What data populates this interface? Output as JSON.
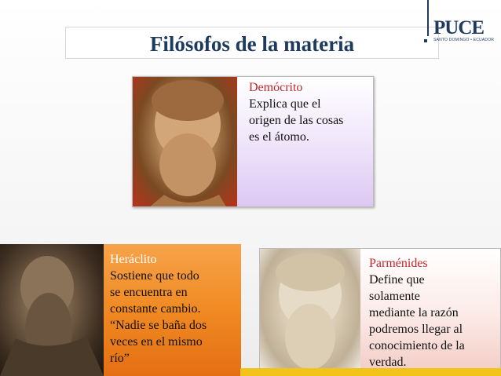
{
  "slide": {
    "title": "Filósofos de la materia"
  },
  "logo": {
    "name": "PUCE",
    "subtitle": "SANTO DOMINGO • ECUADOR"
  },
  "cards": {
    "democrito": {
      "name": "Demócrito",
      "lines": [
        "Explica que el",
        "origen de las cosas",
        "es el átomo."
      ]
    },
    "heraclito": {
      "name": "Heráclito",
      "lines": [
        "Sostiene que todo",
        "se encuentra en",
        "constante cambio.",
        "“Nadie se baña dos",
        "veces en el mismo",
        "río”"
      ]
    },
    "parmenides": {
      "name": "Parménides",
      "lines": [
        "Define que",
        "solamente",
        "mediante la razón",
        "podremos llegar al",
        "conocimiento de la",
        "verdad."
      ]
    }
  },
  "colors": {
    "title": "#1f3a5f",
    "name_accent": "#c0282a",
    "heraclito_panel": "#f08a23",
    "accent_strip": "#f2c318"
  },
  "icons": {
    "logo_mark": "puce-logo-icon"
  }
}
